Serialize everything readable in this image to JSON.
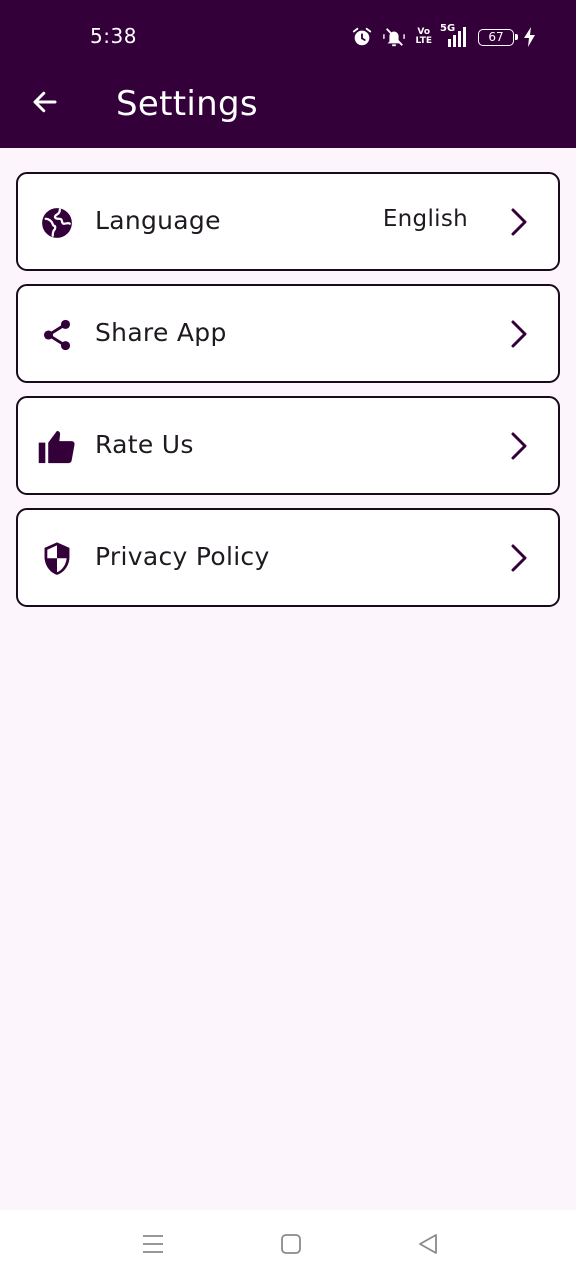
{
  "status_bar": {
    "time": "5:38",
    "network_top": "Vo",
    "network_bottom": "LTE",
    "network_type": "5G",
    "battery_level": "67",
    "icons": [
      "alarm-icon",
      "mute-icon",
      "volte-icon",
      "signal-icon",
      "battery-icon",
      "charging-icon"
    ]
  },
  "app_bar": {
    "title": "Settings",
    "back_icon": "arrow-left-icon"
  },
  "settings": {
    "items": [
      {
        "label": "Language",
        "value": "English",
        "icon": "globe-icon"
      },
      {
        "label": "Share App",
        "icon": "share-icon"
      },
      {
        "label": "Rate Us",
        "icon": "thumbs-up-icon"
      },
      {
        "label": "Privacy Policy",
        "icon": "shield-icon"
      }
    ]
  },
  "nav_bar": {
    "icons": [
      "menu-icon",
      "home-square-icon",
      "back-triangle-icon"
    ]
  },
  "colors": {
    "primary": "#33003a",
    "background": "#fcf6fc",
    "card": "#ffffff",
    "text": "#1f1a21",
    "border": "#1a0a1e"
  }
}
